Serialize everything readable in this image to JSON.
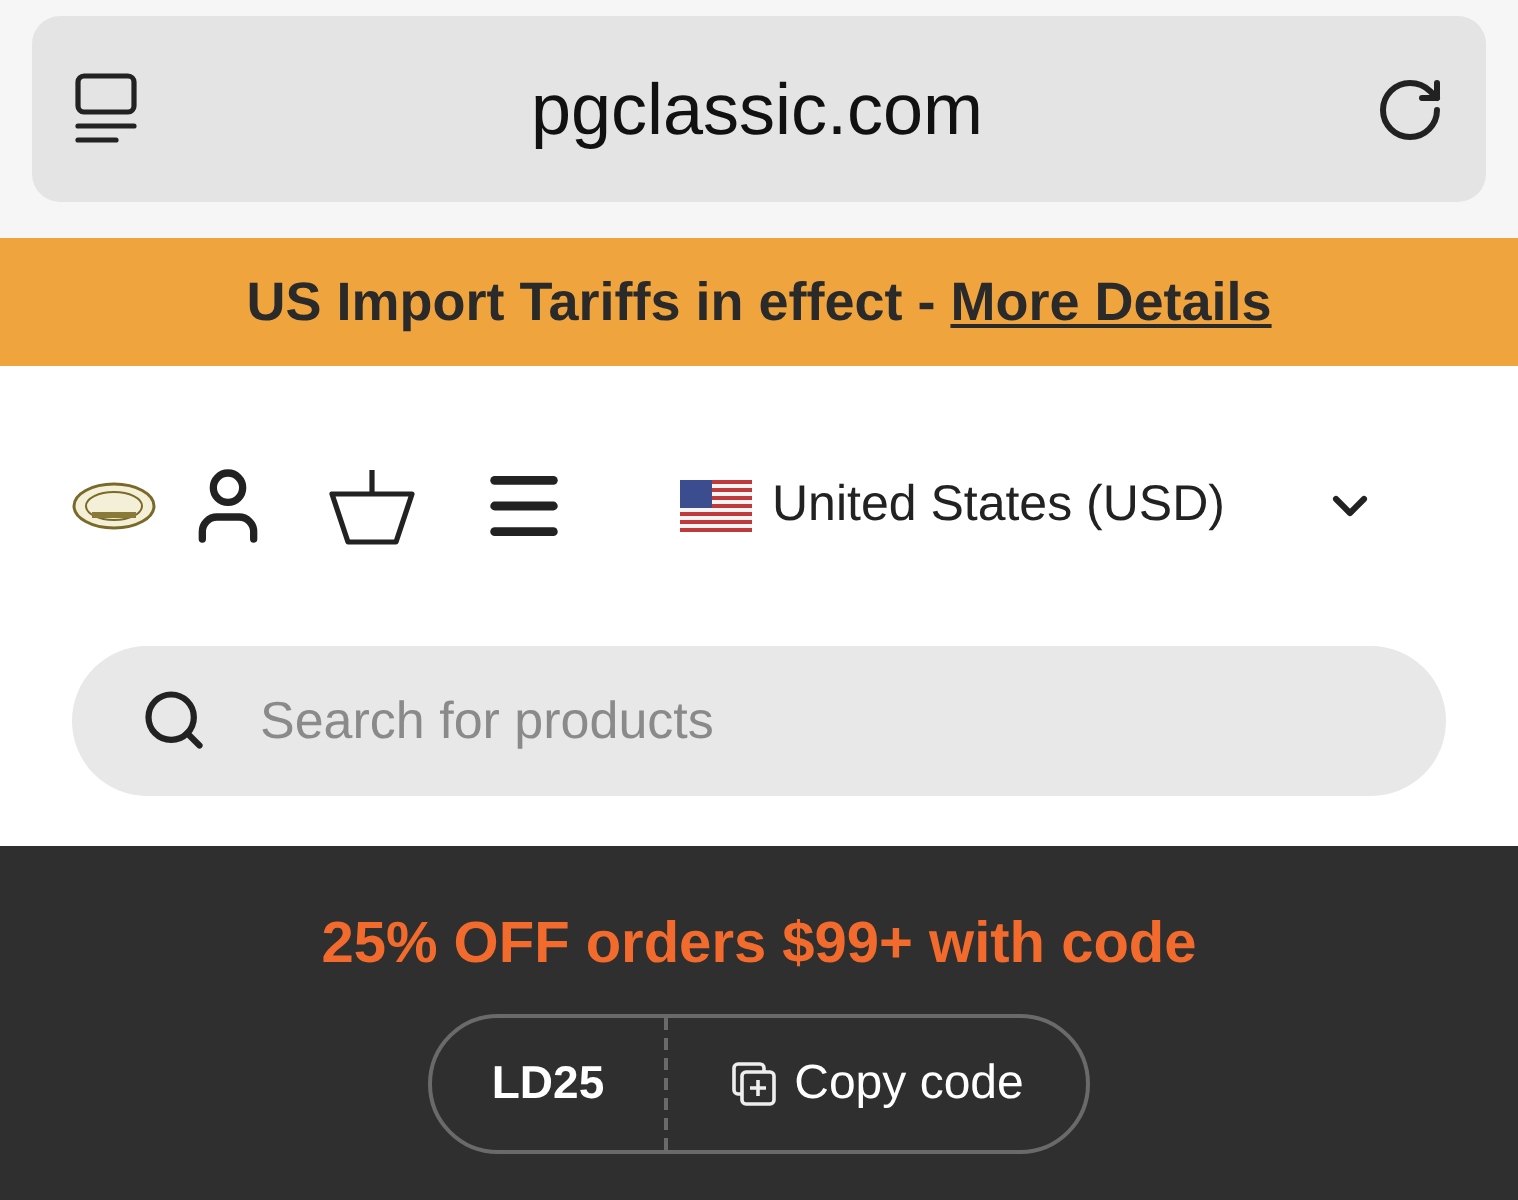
{
  "address_bar": {
    "url": "pgclassic.com"
  },
  "announcement": {
    "text": "US Import Tariffs in effect - ",
    "link": "More Details"
  },
  "header": {
    "country_selector": "United States (USD)"
  },
  "search": {
    "placeholder": "Search for products"
  },
  "promo": {
    "text": "25% OFF orders $99+ with code",
    "code": "LD25",
    "copy_button": "Copy code"
  }
}
